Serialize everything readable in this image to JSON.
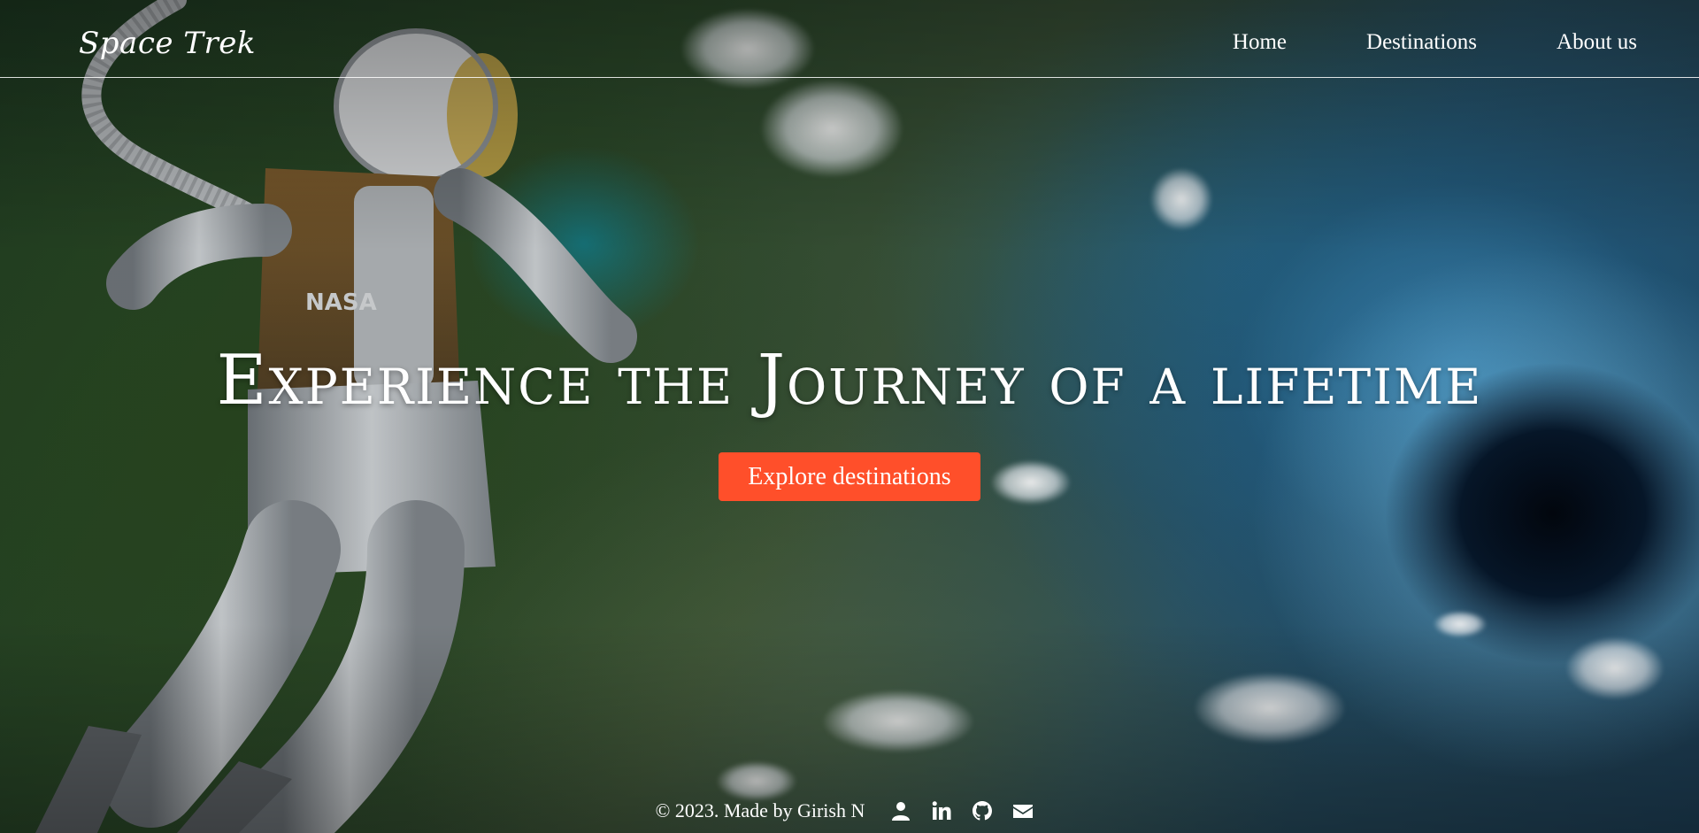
{
  "header": {
    "brand": "Space Trek",
    "nav": [
      {
        "label": "Home"
      },
      {
        "label": "Destinations"
      },
      {
        "label": "About us"
      }
    ]
  },
  "hero": {
    "title": "Experience the Journey of a lifetime",
    "cta_label": "Explore destinations"
  },
  "footer": {
    "copyright": "© 2023. Made by Girish N",
    "icons": [
      "user-icon",
      "linkedin-icon",
      "github-icon",
      "envelope-icon"
    ]
  },
  "colors": {
    "accent": "#ff4f2a",
    "text": "#ffffff"
  }
}
